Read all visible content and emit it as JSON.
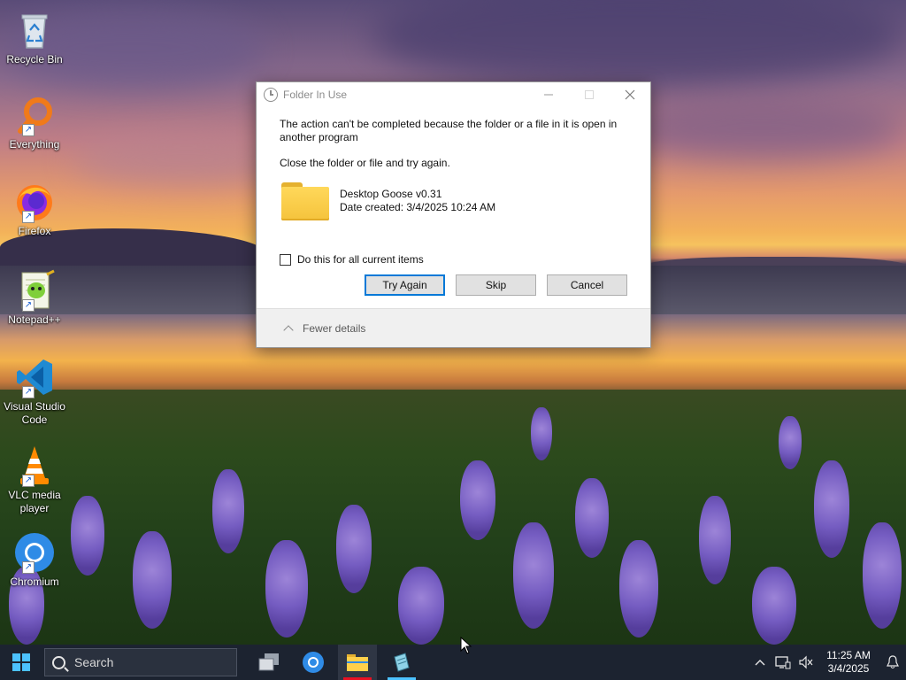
{
  "desktop": {
    "icons": [
      {
        "label": "Recycle Bin",
        "icon": "recycle-bin-icon"
      },
      {
        "label": "Everything",
        "icon": "everything-search-icon"
      },
      {
        "label": "Firefox",
        "icon": "firefox-icon"
      },
      {
        "label": "Notepad++",
        "icon": "notepad-plus-plus-icon"
      },
      {
        "label": "Visual Studio Code",
        "icon": "vscode-icon"
      },
      {
        "label": "VLC media player",
        "icon": "vlc-icon"
      },
      {
        "label": "Chromium",
        "icon": "chromium-icon"
      }
    ]
  },
  "dialog": {
    "title": "Folder In Use",
    "message": "The action can't be completed because the folder or a file in it is open in another program",
    "instruction": "Close the folder or file and try again.",
    "file_name": "Desktop Goose v0.31",
    "file_date": "Date created: 3/4/2025 10:24 AM",
    "checkbox_label": "Do this for all current items",
    "checkbox_checked": false,
    "buttons": {
      "try_again": "Try Again",
      "skip": "Skip",
      "cancel": "Cancel"
    },
    "details_toggle": "Fewer details"
  },
  "taskbar": {
    "search_placeholder": "Search",
    "apps": [
      "task-view-icon",
      "chromium-icon",
      "file-explorer-icon",
      "notepad-icon"
    ],
    "time": "11:25 AM",
    "date": "3/4/2025"
  },
  "colors": {
    "accent": "#0078d7",
    "taskbar_bg": "#1c2330",
    "explorer_indicator": "#e81123",
    "notepad_indicator": "#4cc2ff"
  }
}
